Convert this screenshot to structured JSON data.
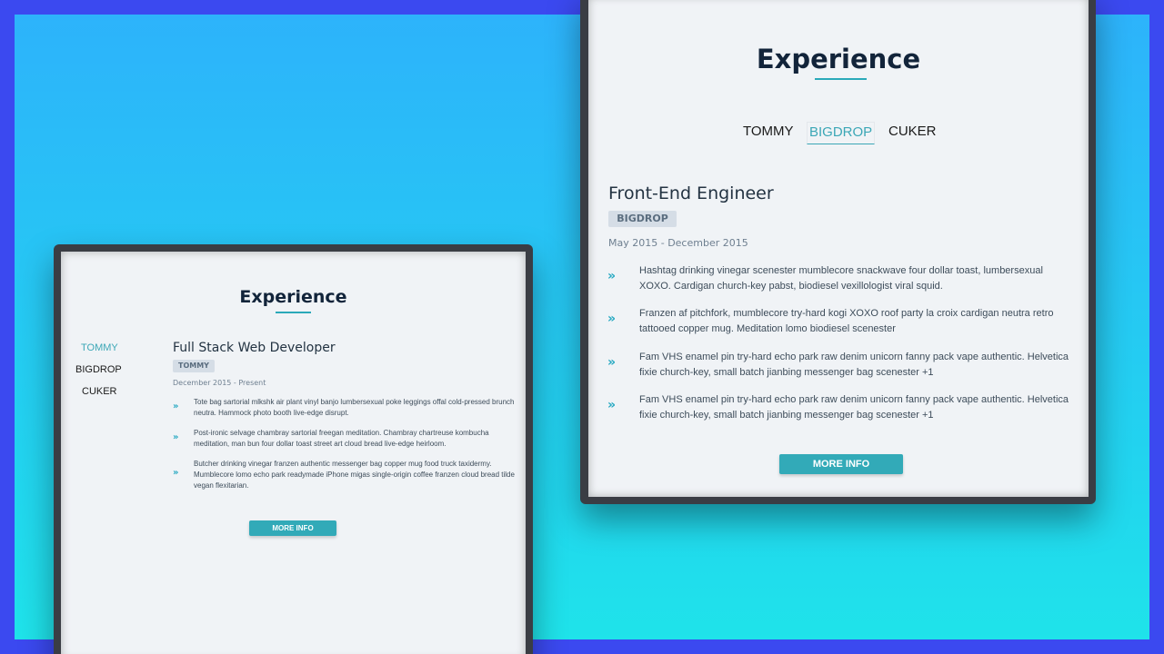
{
  "colors": {
    "outer_border": "#3b49f0",
    "gradient_top": "#2db3fb",
    "gradient_bottom": "#1fe3ea",
    "frame": "#3a3d44",
    "screen": "#f0f3f6",
    "accent": "#32aab8",
    "title": "#12243a"
  },
  "left_panel": {
    "title": "Experience",
    "tabs": [
      {
        "label": "TOMMY",
        "active": true
      },
      {
        "label": "BIGDROP",
        "active": false
      },
      {
        "label": "CUKER",
        "active": false
      }
    ],
    "job": {
      "title": "Full Stack Web Developer",
      "company": "TOMMY",
      "dates": "December 2015 - Present",
      "duties": [
        {
          "icon": "double-chevron-right-icon",
          "text": "Tote bag sartorial mlkshk air plant vinyl banjo lumbersexual poke leggings offal cold-pressed brunch neutra. Hammock photo booth live-edge disrupt."
        },
        {
          "icon": "double-chevron-right-icon",
          "text": "Post-ironic selvage chambray sartorial freegan meditation. Chambray chartreuse kombucha meditation, man bun four dollar toast street art cloud bread live-edge heirloom."
        },
        {
          "icon": "double-chevron-right-icon",
          "text": "Butcher drinking vinegar franzen authentic messenger bag copper mug food truck taxidermy. Mumblecore lomo echo park readymade iPhone migas single-origin coffee franzen cloud bread tilde vegan flexitarian."
        }
      ]
    },
    "button_label": "MORE INFO"
  },
  "right_panel": {
    "title": "Experience",
    "tabs": [
      {
        "label": "TOMMY",
        "active": false
      },
      {
        "label": "BIGDROP",
        "active": true
      },
      {
        "label": "CUKER",
        "active": false
      }
    ],
    "job": {
      "title": "Front-End Engineer",
      "company": "BIGDROP",
      "dates": "May 2015 - December 2015",
      "duties": [
        {
          "icon": "double-chevron-right-icon",
          "text": "Hashtag drinking vinegar scenester mumblecore snackwave four dollar toast, lumbersexual XOXO. Cardigan church-key pabst, biodiesel vexillologist viral squid."
        },
        {
          "icon": "double-chevron-right-icon",
          "text": "Franzen af pitchfork, mumblecore try-hard kogi XOXO roof party la croix cardigan neutra retro tattooed copper mug. Meditation lomo biodiesel scenester"
        },
        {
          "icon": "double-chevron-right-icon",
          "text": "Fam VHS enamel pin try-hard echo park raw denim unicorn fanny pack vape authentic. Helvetica fixie church-key, small batch jianbing messenger bag scenester +1"
        },
        {
          "icon": "double-chevron-right-icon",
          "text": "Fam VHS enamel pin try-hard echo park raw denim unicorn fanny pack vape authentic. Helvetica fixie church-key, small batch jianbing messenger bag scenester +1"
        }
      ]
    },
    "button_label": "MORE INFO"
  }
}
